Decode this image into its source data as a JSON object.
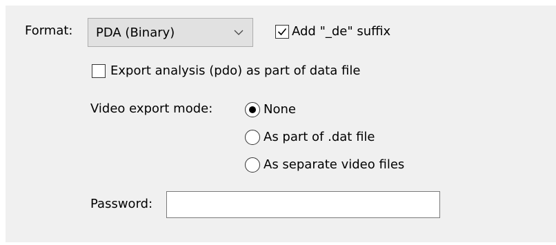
{
  "format": {
    "label": "Format:",
    "selected": "PDA (Binary)",
    "chevron_icon": "chevron-down-icon"
  },
  "suffix_checkbox": {
    "label": "Add \"_de\" suffix",
    "checked": true
  },
  "export_analysis_checkbox": {
    "label": "Export analysis (pdo) as part of data file",
    "checked": false
  },
  "video_export": {
    "label": "Video export mode:",
    "options": [
      {
        "label": "None",
        "selected": true
      },
      {
        "label": "As part of .dat file",
        "selected": false
      },
      {
        "label": "As separate video files",
        "selected": false
      }
    ]
  },
  "password": {
    "label": "Password:",
    "value": ""
  }
}
